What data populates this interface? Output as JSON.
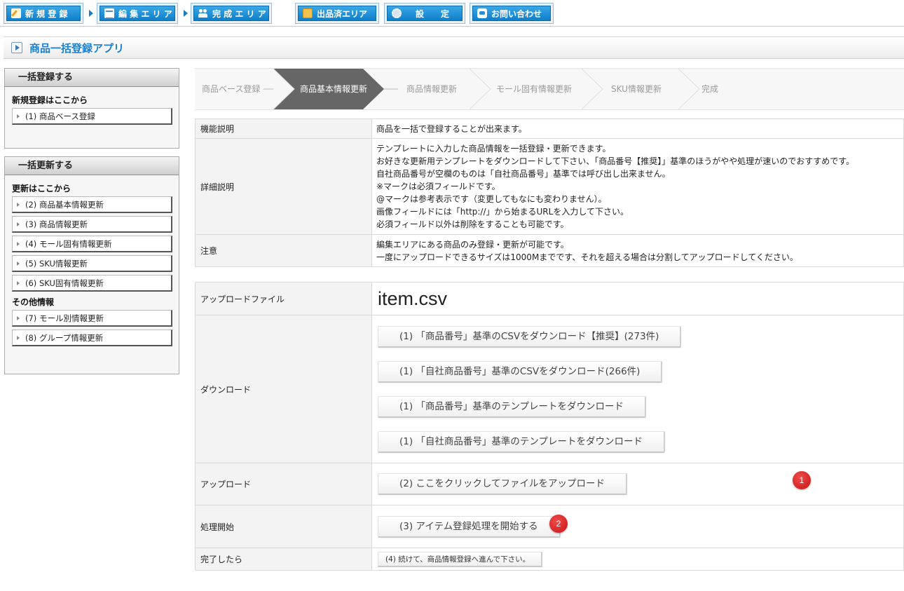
{
  "nav": {
    "items": [
      {
        "label": "新 規 登 録",
        "icon": "pencil-icon"
      },
      {
        "label": "編 集 エ リ ア",
        "icon": "grid-icon"
      },
      {
        "label": "完 成 エ リ ア",
        "icon": "people-icon"
      },
      {
        "label": "出品済エリア",
        "icon": "box-icon"
      },
      {
        "label": "設　　定",
        "icon": "gear-icon"
      },
      {
        "label": "お問い合わせ",
        "icon": "chat-icon"
      }
    ]
  },
  "page": {
    "title": "商品一括登録アプリ"
  },
  "sidebar": {
    "register": {
      "header": "一括登録する",
      "sub": "新規登録はここから",
      "items": [
        "(1) 商品ベース登録"
      ]
    },
    "update": {
      "header": "一括更新する",
      "sub": "更新はここから",
      "items": [
        "(2) 商品基本情報更新",
        "(3) 商品情報更新",
        "(4) モール固有情報更新",
        "(5) SKU情報更新",
        "(6) SKU固有情報更新"
      ],
      "other_sub": "その他情報",
      "other_items": [
        "(7) モール別情報更新",
        "(8) グループ情報更新"
      ]
    }
  },
  "steps": {
    "items": [
      "商品ベース登録",
      "商品基本情報更新",
      "商品情報更新",
      "モール固有情報更新",
      "SKU情報更新",
      "完成"
    ],
    "active_index": 1
  },
  "info": {
    "rows": [
      {
        "label": "機能説明",
        "lines": [
          "商品を一括で登録することが出来ます。"
        ]
      },
      {
        "label": "詳細説明",
        "lines": [
          "テンプレートに入力した商品情報を一括登録・更新できます。",
          "お好きな更新用テンプレートをダウンロードして下さい、「商品番号【推奨】」基準のほうがやや処理が速いのでおすすめです。",
          "自社商品番号が空欄のものは「自社商品番号」基準では呼び出し出来ません。",
          "※マークは必須フィールドです。",
          "@マークは参考表示です（変更してもなにも変わりません）。",
          "画像フィールドには「http://」から始まるURLを入力して下さい。",
          "必須フィールド以外は削除をすることも可能です。"
        ]
      },
      {
        "label": "注意",
        "lines": [
          "編集エリアにある商品のみ登録・更新が可能です。",
          "一度にアップロードできるサイズは1000Mまでです、それを超える場合は分割してアップロードしてください。"
        ]
      }
    ]
  },
  "upload": {
    "file_label": "アップロードファイル",
    "file_name": "item.csv",
    "download_label": "ダウンロード",
    "download_buttons": [
      "(1) 「商品番号」基準のCSVをダウンロード【推奨】(273件)",
      "(1) 「自社商品番号」基準のCSVをダウンロード(266件)",
      "(1) 「商品番号」基準のテンプレートをダウンロード",
      "(1) 「自社商品番号」基準のテンプレートをダウンロード"
    ],
    "upload_label": "アップロード",
    "upload_button": "(2) ここをクリックしてファイルをアップロード",
    "upload_badge": "1",
    "process_label": "処理開始",
    "process_button": "(3) アイテム登録処理を開始する",
    "process_badge": "2",
    "done_label": "完了したら",
    "done_button": "(4) 続けて、商品情報登録へ進んで下さい。"
  }
}
